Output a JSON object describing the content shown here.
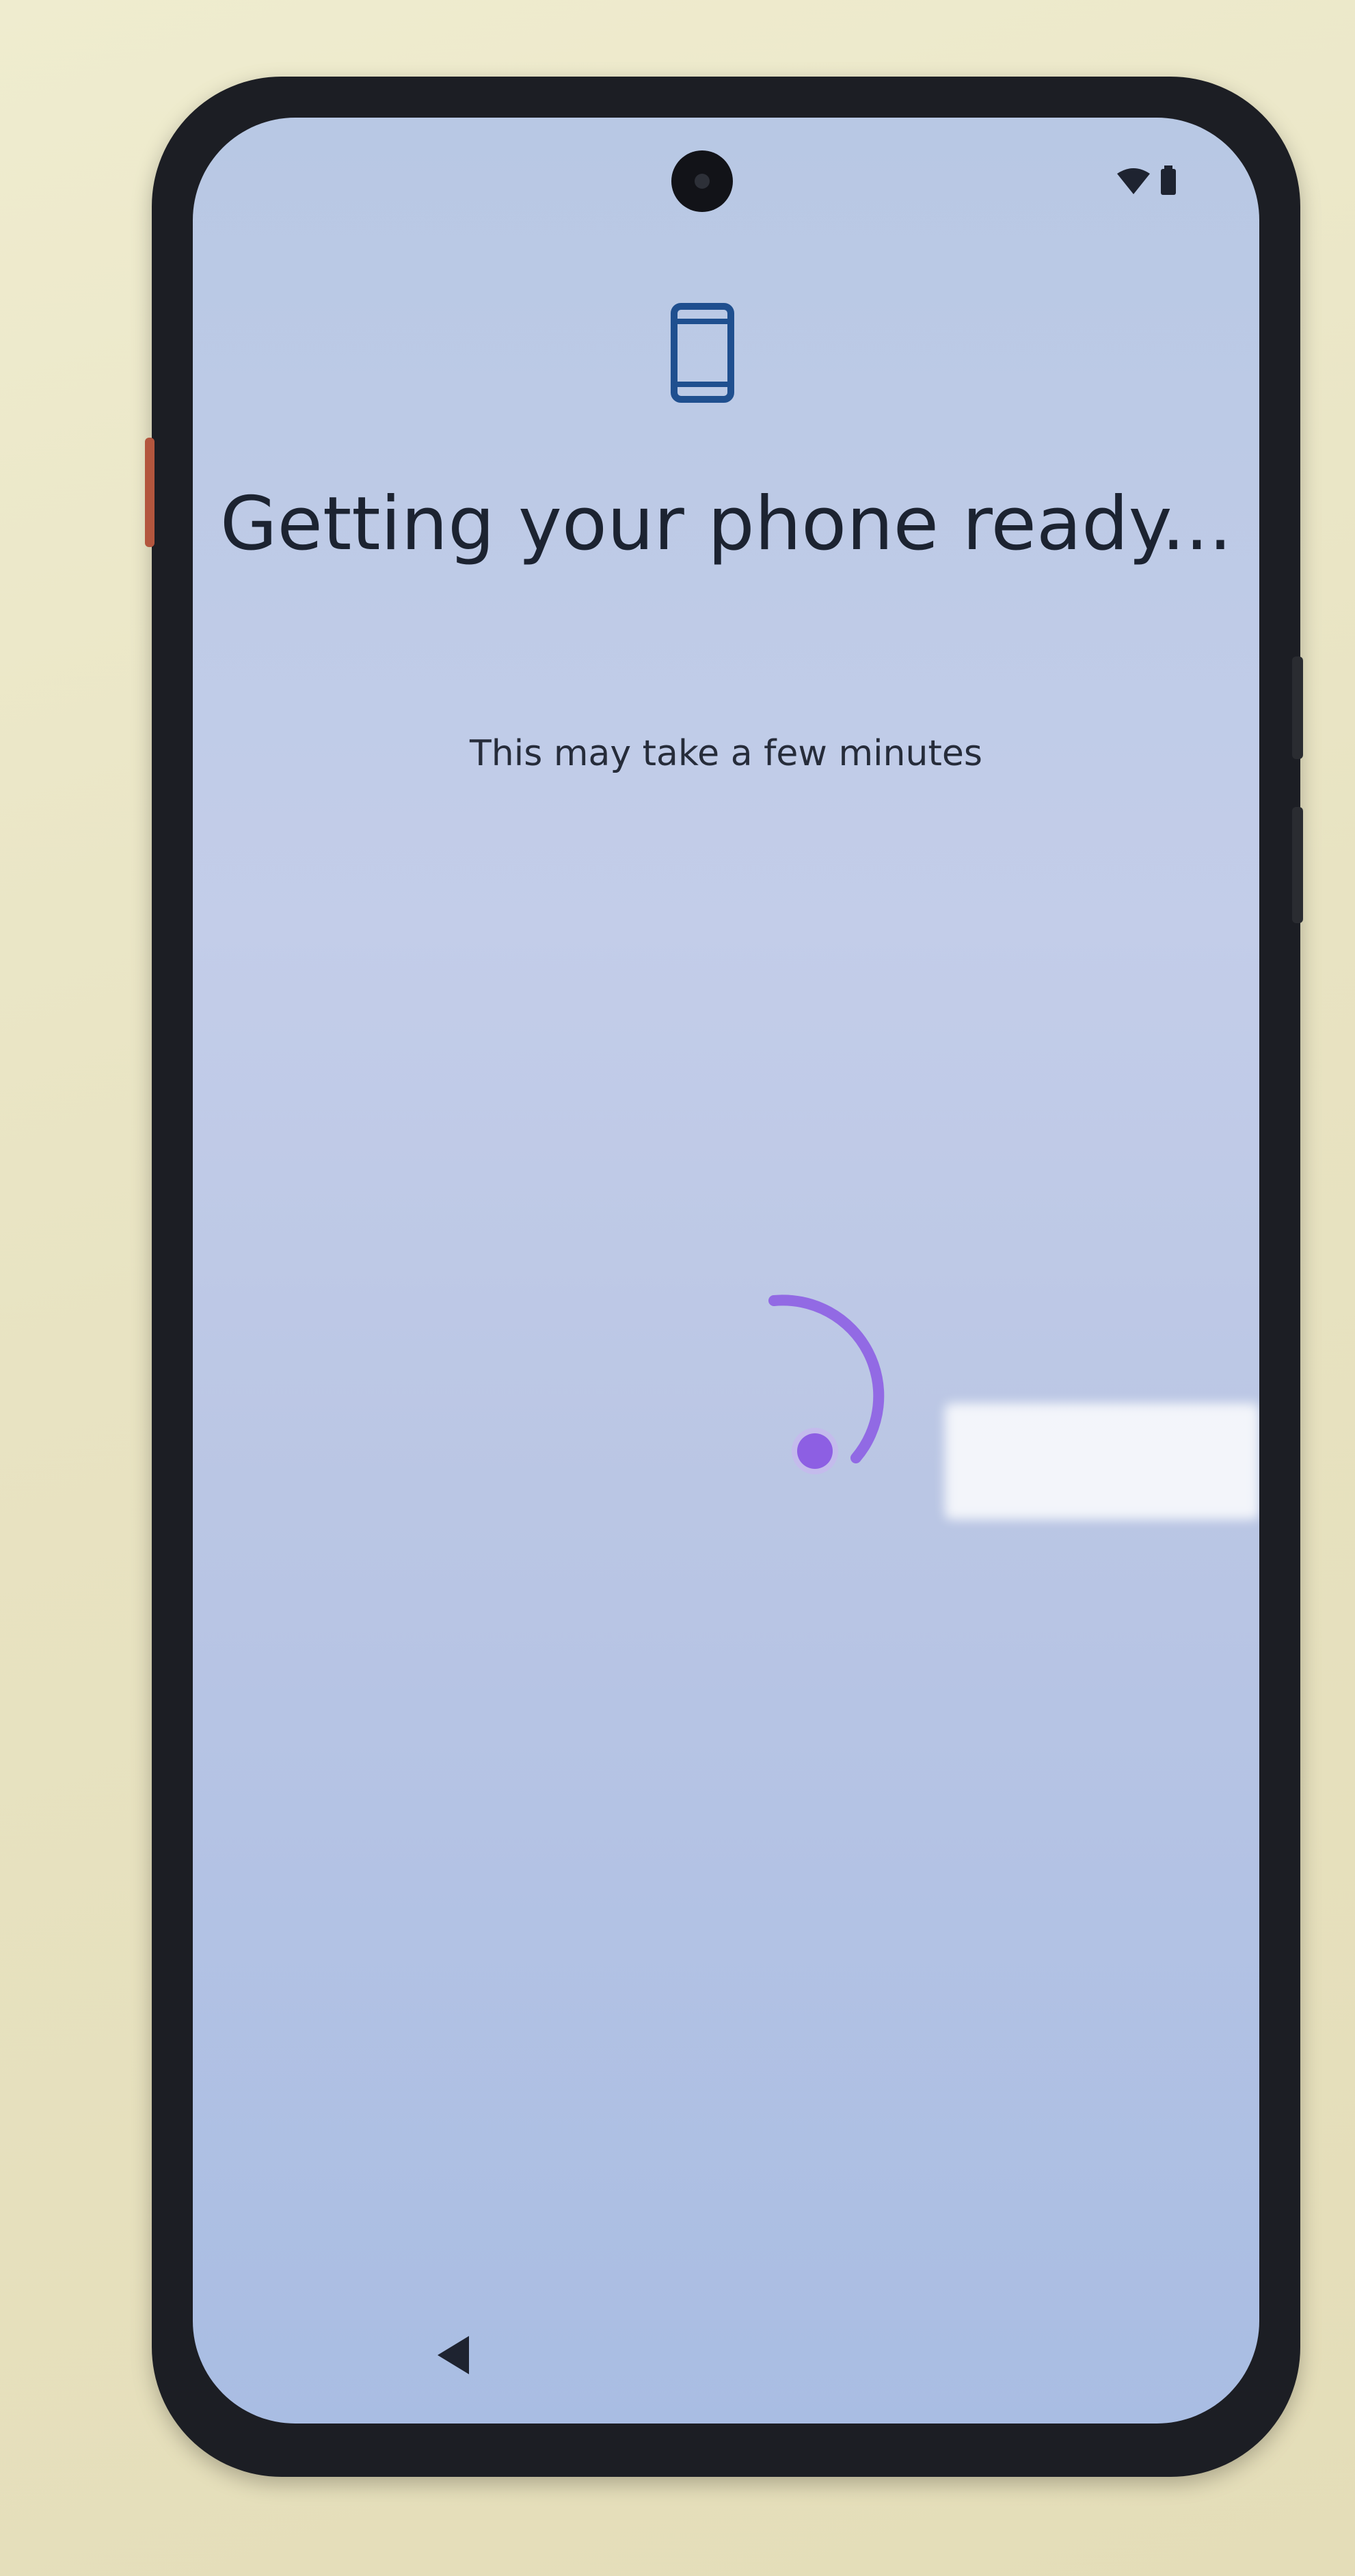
{
  "screen": {
    "title": "Getting your phone ready...",
    "subtitle": "This may take a few minutes",
    "header_icon": "phone-device-icon",
    "status_bar": {
      "icons": [
        "wifi-icon",
        "battery-icon"
      ]
    },
    "progress_indicator": "loading-spinner",
    "navigation": {
      "back_icon": "back-triangle-icon"
    }
  },
  "colors": {
    "accent": "#8d5fe3",
    "icon_blue": "#1f4f8f",
    "text": "#1c2331"
  }
}
